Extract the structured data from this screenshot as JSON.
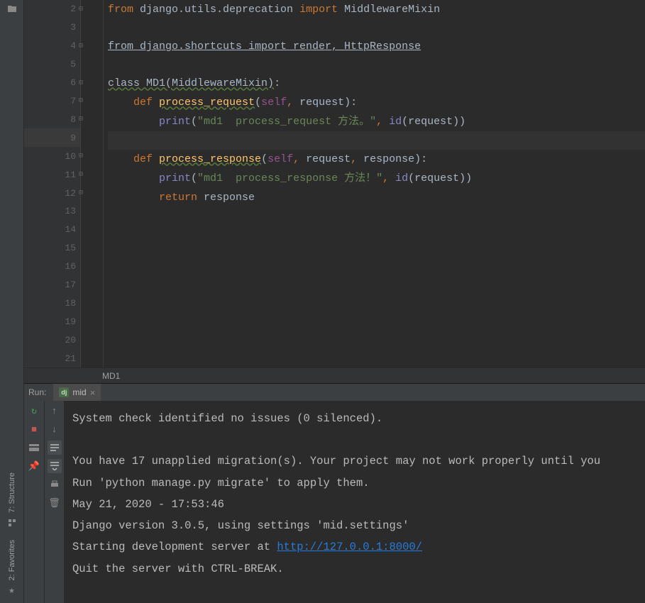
{
  "sidebar": {
    "labels": [
      "7: Structure",
      "2: Favorites"
    ]
  },
  "editor": {
    "lines": [
      2,
      3,
      4,
      5,
      6,
      7,
      8,
      9,
      10,
      11,
      12,
      13,
      14,
      15,
      16,
      17,
      18,
      19,
      20,
      21
    ],
    "current_line": 9,
    "code": {
      "l2_from": "from",
      "l2_mod": " django.utils.deprecation ",
      "l2_import": "import",
      "l2_cls": " MiddlewareMixin",
      "l4_full": "from django.shortcuts import render, HttpResponse",
      "l6_class": "class ",
      "l6_name": "MD1",
      "l6_paren": "(MiddlewareMixin)",
      "l6_colon": ":",
      "l7_def": "def ",
      "l7_name": "process_request",
      "l7_p1": "(",
      "l7_self": "self",
      "l7_c": ",",
      "l7_p2": " request)",
      "l7_colon": ":",
      "l8_print": "print",
      "l8_p1": "(",
      "l8_str": "\"md1  process_request 方法。\"",
      "l8_c": ",",
      "l8_id": " id",
      "l8_p2": "(request))",
      "l10_def": "def ",
      "l10_name": "process_response",
      "l10_p1": "(",
      "l10_self": "self",
      "l10_c": ",",
      "l10_p2": " request",
      "l10_c2": ",",
      "l10_p3": " response)",
      "l10_colon": ":",
      "l11_print": "print",
      "l11_p1": "(",
      "l11_str": "\"md1  process_response 方法！\"",
      "l11_c": ",",
      "l11_id": " id",
      "l11_p2": "(request))",
      "l12_ret": "return",
      "l12_val": " response"
    }
  },
  "breadcrumb": "MD1",
  "run": {
    "label": "Run:",
    "tab": "mid",
    "console": {
      "l1": "System check identified no issues (0 silenced).",
      "l2": "",
      "l3": "You have 17 unapplied migration(s). Your project may not work properly until you",
      "l4": "Run 'python manage.py migrate' to apply them.",
      "l5": "May 21, 2020 - 17:53:46",
      "l6": "Django version 3.0.5, using settings 'mid.settings'",
      "l7a": "Starting development server at ",
      "l7_link": "http://127.0.0.1:8000/",
      "l8": "Quit the server with CTRL-BREAK."
    }
  }
}
